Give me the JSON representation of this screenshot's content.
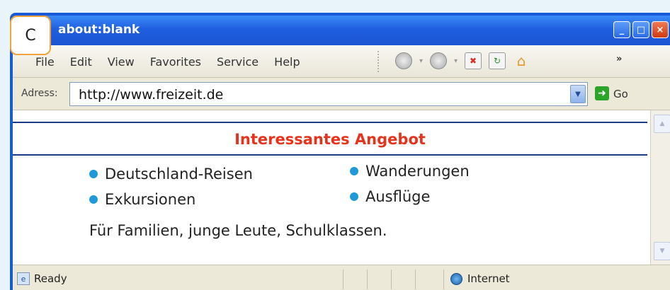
{
  "window": {
    "title": "about:blank",
    "controls": [
      "minimize-icon",
      "maximize-icon",
      "close-icon"
    ]
  },
  "badge": {
    "label": "C"
  },
  "menubar": {
    "items": [
      "File",
      "Edit",
      "View",
      "Favorites",
      "Service",
      "Help"
    ],
    "toolbar_icons": [
      "back-icon",
      "forward-icon",
      "stop-icon",
      "refresh-icon",
      "home-icon"
    ],
    "overflow": "»"
  },
  "addressbar": {
    "label": "Adress:",
    "url": "http://www.freizeit.de",
    "go_label": "Go"
  },
  "content": {
    "heading": "Interessantes Angebot",
    "bullets": [
      "Deutschland-Reisen",
      "Wanderungen",
      "Exkursionen",
      "Ausflüge"
    ],
    "footer": "Für Familien, junge Leute, Schulklassen."
  },
  "statusbar": {
    "status": "Ready",
    "zone": "Internet"
  },
  "colors": {
    "title_bar": "#1f5fe0",
    "heading": "#e8331c",
    "bullet": "#1e9ad8",
    "rule": "#1b3a8a",
    "badge_border": "#f3a23c"
  }
}
